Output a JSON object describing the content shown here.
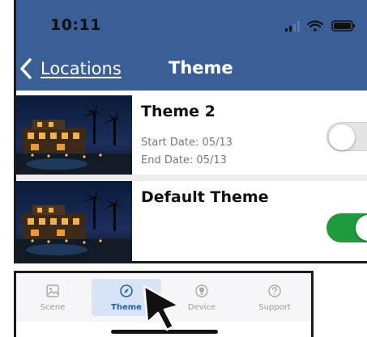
{
  "status_bar": {
    "time": "10:11"
  },
  "nav": {
    "back_label": "Locations",
    "title": "Theme"
  },
  "themes": [
    {
      "name": "Theme 2",
      "start_date": "Start Date: 05/13",
      "end_date": "End Date: 05/13",
      "enabled": false
    },
    {
      "name": "Default Theme",
      "enabled": true
    }
  ],
  "tabs": [
    {
      "label": "Scene",
      "icon": "image-icon",
      "active": false
    },
    {
      "label": "Theme",
      "icon": "compass-icon",
      "active": true
    },
    {
      "label": "Device",
      "icon": "device-icon",
      "active": false
    },
    {
      "label": "Support",
      "icon": "help-icon",
      "active": false
    }
  ],
  "colors": {
    "header": "#3a5f97",
    "toggle_on": "#1f9a3d",
    "toggle_off": "#e4e4e4",
    "active_tab_bg": "#d7e3f7",
    "active_tab_text": "#2a5ea8"
  }
}
